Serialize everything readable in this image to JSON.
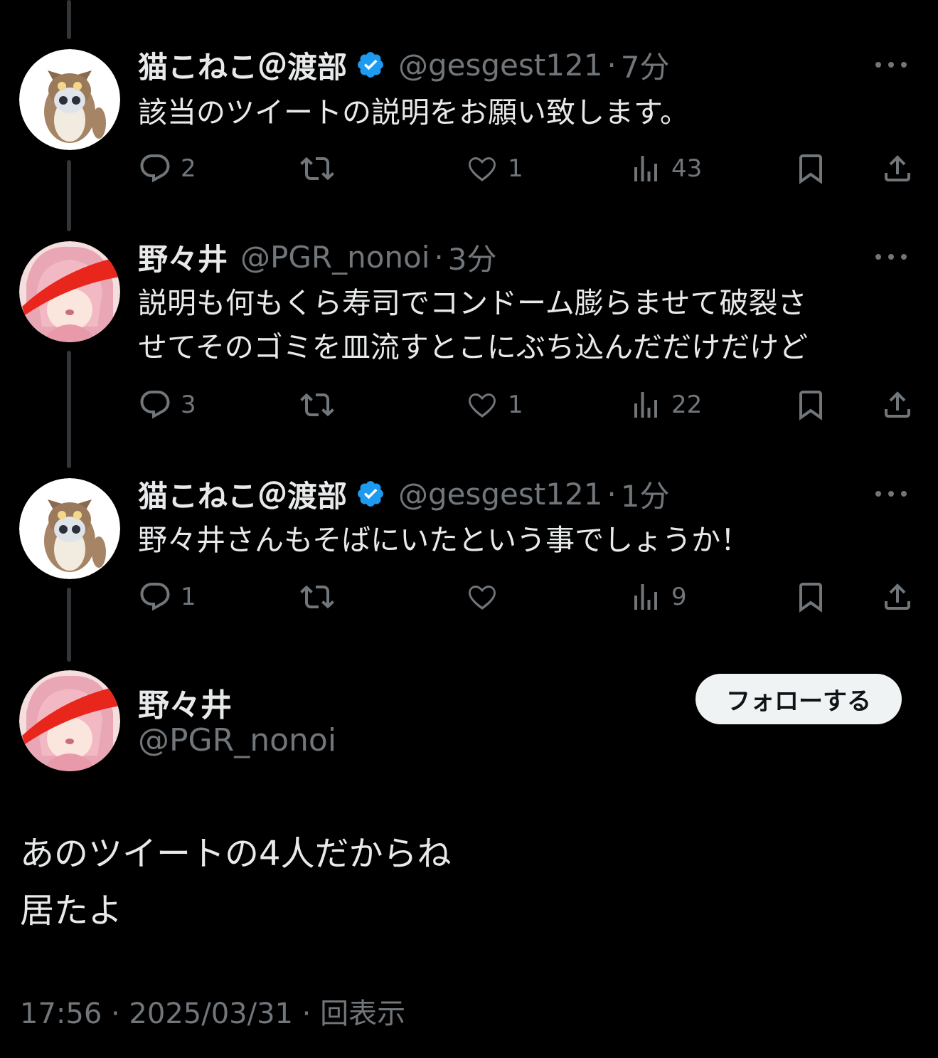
{
  "replies": [
    {
      "name": "猫こねこ＠渡部",
      "verified": true,
      "handle": "@gesgest121",
      "time": "7分",
      "avatar": "owl-raccoon-avatar",
      "lines": [
        "該当のツイートの説明をお願い致します。"
      ],
      "stats": {
        "replies": "2",
        "retweets": "",
        "likes": "1",
        "views": "43"
      }
    },
    {
      "name": "野々井",
      "verified": false,
      "handle": "@PGR_nonoi",
      "time": "3分",
      "avatar": "pink-hair-girl-avatar",
      "lines": [
        "説明も何もくら寿司でコンドーム膨らませて破裂さ",
        "せてそのゴミを皿流すとこにぶち込んだだけだけど"
      ],
      "stats": {
        "replies": "3",
        "retweets": "",
        "likes": "1",
        "views": "22"
      }
    },
    {
      "name": "猫こねこ＠渡部",
      "verified": true,
      "handle": "@gesgest121",
      "time": "1分",
      "avatar": "owl-raccoon-avatar",
      "lines": [
        "野々井さんもそばにいたという事でしょうか！"
      ],
      "stats": {
        "replies": "1",
        "retweets": "",
        "likes": "",
        "views": "9"
      }
    }
  ],
  "separator": "·",
  "main_tweet": {
    "name": "野々井",
    "handle": "@PGR_nonoi",
    "follow_label": "フォローする",
    "lines": [
      "あのツイートの4人だからね",
      "居たよ"
    ],
    "meta": "17:56 · 2025/03/31 · 回表示"
  },
  "icons": {
    "reply": "reply-icon",
    "retweet": "retweet-icon",
    "like": "heart-icon",
    "views": "views-icon",
    "bookmark": "bookmark-icon",
    "share": "share-icon",
    "more": "more-icon",
    "verified": "verified-badge-icon"
  },
  "colors": {
    "background": "#000000",
    "text": "#e7e9ea",
    "muted": "#71767b",
    "verified": "#1d9bf0",
    "thread_line": "#333639",
    "redaction": "#e8261c"
  }
}
